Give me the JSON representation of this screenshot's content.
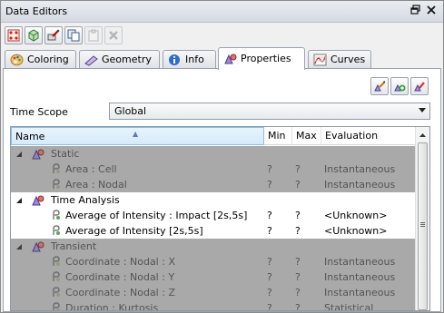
{
  "window": {
    "title": "Data Editors",
    "restore_icon": "restore-icon",
    "close_icon": "close-icon"
  },
  "toolbar": [
    "model-view-icon",
    "cube-add-icon",
    "node-edit-icon",
    "copy-icon",
    "paste-icon",
    "delete-icon"
  ],
  "tabs": [
    {
      "label": "Coloring",
      "icon": "palette-icon"
    },
    {
      "label": "Geometry",
      "icon": "geometry-icon"
    },
    {
      "label": "Info",
      "icon": "info-icon"
    },
    {
      "label": "Properties",
      "icon": "properties-icon",
      "active": true
    },
    {
      "label": "Curves",
      "icon": "curves-icon"
    }
  ],
  "time_scope": {
    "label": "Time Scope",
    "value": "Global"
  },
  "grid": {
    "columns": [
      "Name",
      "Min",
      "Max",
      "Evaluation"
    ],
    "sorted_column": "Name",
    "groups": [
      {
        "name": "Static",
        "shaded": true,
        "items": [
          {
            "name": "Area : Cell",
            "min": "?",
            "max": "?",
            "evaluation": "Instantaneous"
          },
          {
            "name": "Area : Nodal",
            "min": "?",
            "max": "?",
            "evaluation": "Instantaneous"
          }
        ]
      },
      {
        "name": "Time Analysis",
        "shaded": false,
        "items": [
          {
            "name": "Average of Intensity : Impact [2s,5s]",
            "min": "?",
            "max": "?",
            "evaluation": "<Unknown>"
          },
          {
            "name": "Average of Intensity [2s,5s]",
            "min": "?",
            "max": "?",
            "evaluation": "<Unknown>"
          }
        ]
      },
      {
        "name": "Transient",
        "shaded": true,
        "items": [
          {
            "name": "Coordinate : Nodal : X",
            "min": "?",
            "max": "?",
            "evaluation": "Instantaneous"
          },
          {
            "name": "Coordinate : Nodal : Y",
            "min": "?",
            "max": "?",
            "evaluation": "Instantaneous"
          },
          {
            "name": "Coordinate : Nodal : Z",
            "min": "?",
            "max": "?",
            "evaluation": "Instantaneous"
          },
          {
            "name": "Duration : Kurtosis",
            "min": "?",
            "max": "?",
            "evaluation": "Statistical"
          }
        ]
      }
    ]
  },
  "colors": {
    "shaded_row": "#a9a9a9",
    "shaded_text": "#545454",
    "accent": "#8ac0e6"
  }
}
